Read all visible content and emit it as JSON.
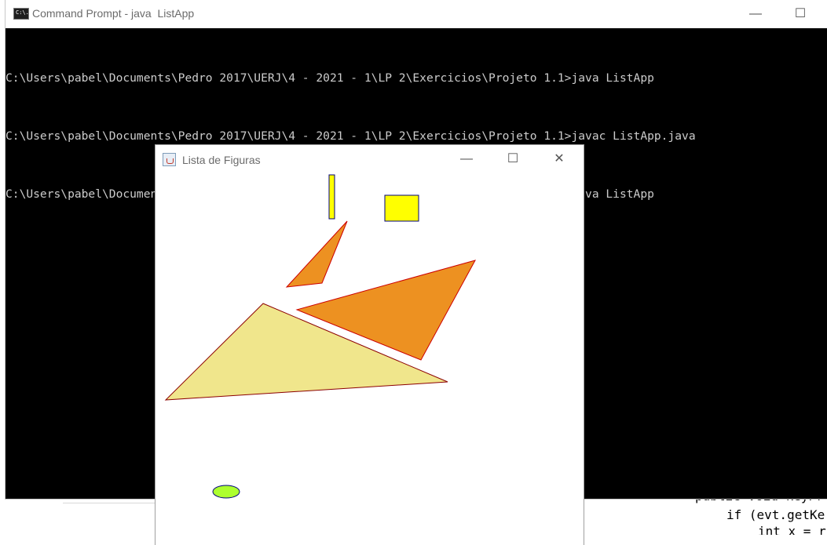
{
  "background_editor": {
    "lines": [
      "public void keyPr",
      "if (evt.getKe",
      "int x = r"
    ]
  },
  "cmd": {
    "title": "Command Prompt - java  ListApp",
    "icon_label": "C:\\.",
    "minimize_glyph": "—",
    "maximize_glyph": "☐",
    "lines": [
      "C:\\Users\\pabel\\Documents\\Pedro 2017\\UERJ\\4 - 2021 - 1\\LP 2\\Exercicios\\Projeto 1.1>java ListApp",
      "C:\\Users\\pabel\\Documents\\Pedro 2017\\UERJ\\4 - 2021 - 1\\LP 2\\Exercicios\\Projeto 1.1>javac ListApp.java",
      "C:\\Users\\pabel\\Documents\\Pedro 2017\\UERJ\\4 - 2021 - 1\\LP 2\\Exercicios\\Projeto 1.1>java ListApp"
    ]
  },
  "java_window": {
    "title": "Lista de Figuras",
    "minimize_glyph": "—",
    "maximize_glyph": "☐",
    "close_glyph": "✕"
  },
  "figures": [
    {
      "kind": "rectangle",
      "name": "thin-yellow-rect",
      "fill": "#ffff00",
      "stroke": "#000080"
    },
    {
      "kind": "rectangle",
      "name": "yellow-rect",
      "fill": "#ffff00",
      "stroke": "#000080"
    },
    {
      "kind": "triangle",
      "name": "orange-small-triangle",
      "fill": "#ed9121",
      "stroke": "#cc0000"
    },
    {
      "kind": "triangle",
      "name": "orange-large-triangle",
      "fill": "#ed9121",
      "stroke": "#cc0000"
    },
    {
      "kind": "triangle",
      "name": "khaki-triangle",
      "fill": "#f0e68c",
      "stroke": "#8b0000"
    },
    {
      "kind": "ellipse",
      "name": "green-ellipse",
      "fill": "#adff2f",
      "stroke": "#000080"
    }
  ]
}
